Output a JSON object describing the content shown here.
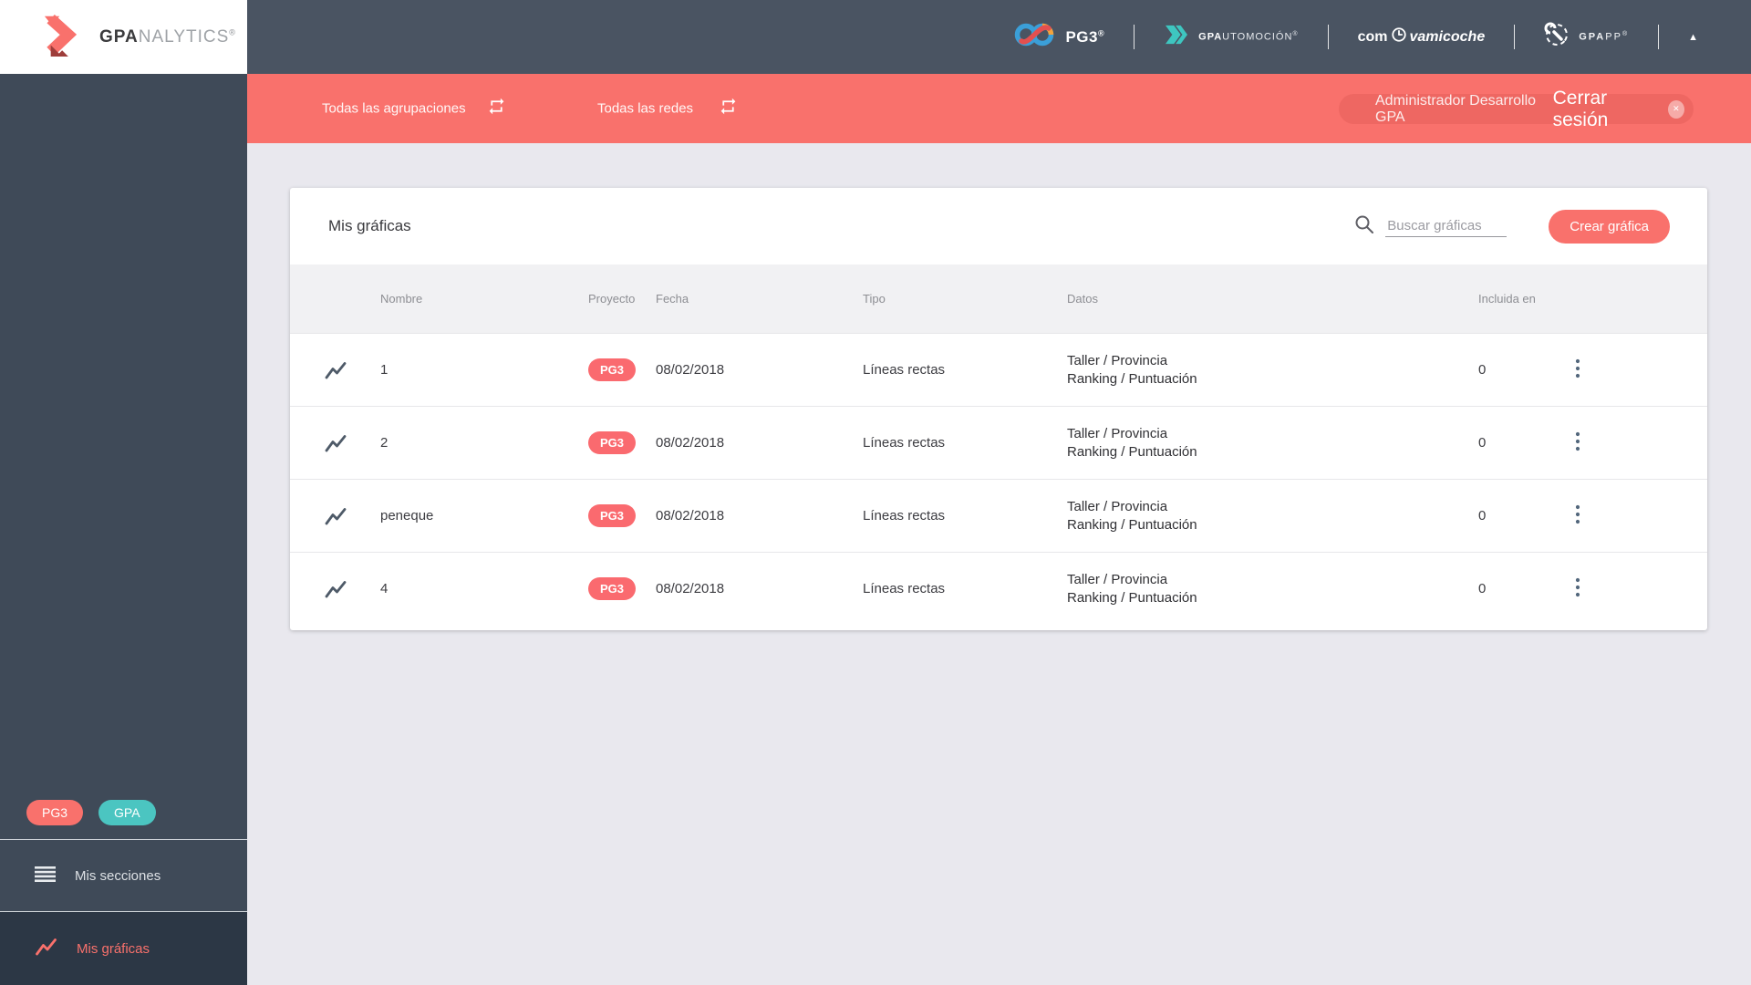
{
  "brand": {
    "name_bold": "GPA",
    "name_light": "NALYTICS",
    "reg": "®"
  },
  "header": {
    "pg3": {
      "label": "PG3",
      "reg": "®"
    },
    "gpautomocion": {
      "bold": "GPA",
      "rest": "UTOMOCIÓN",
      "reg": "®"
    },
    "compravamicoche": {
      "pre": "com",
      "post": "vamicoche"
    },
    "gpapp": {
      "bold": "GPA",
      "rest": "PP",
      "reg": "®"
    },
    "collapse_arrow": "▲"
  },
  "filterbar": {
    "agrupaciones_label": "Todas las agrupaciones",
    "redes_label": "Todas las redes",
    "user_name": "Administrador Desarrollo GPA",
    "logout_label": "Cerrar sesión",
    "logout_icon": "✕"
  },
  "sidebar": {
    "badges": [
      {
        "label": "PG3",
        "color": "#f9716c"
      },
      {
        "label": "GPA",
        "color": "#4bc5c1"
      }
    ],
    "items": [
      {
        "label": "Mis secciones",
        "active": false
      },
      {
        "label": "Mis gráficas",
        "active": true
      }
    ]
  },
  "main": {
    "title": "Mis gráficas",
    "search_placeholder": "Buscar gráficas",
    "create_button": "Crear gráfica",
    "table": {
      "columns": [
        "Nombre",
        "Proyecto",
        "Fecha",
        "Tipo",
        "Datos",
        "Incluida en"
      ],
      "rows": [
        {
          "nombre": "1",
          "proyecto": "PG3",
          "fecha": "08/02/2018",
          "tipo": "Líneas rectas",
          "datos_line1": "Taller / Provincia",
          "datos_line2": "Ranking / Puntuación",
          "incluida": "0"
        },
        {
          "nombre": "2",
          "proyecto": "PG3",
          "fecha": "08/02/2018",
          "tipo": "Líneas rectas",
          "datos_line1": "Taller / Provincia",
          "datos_line2": "Ranking / Puntuación",
          "incluida": "0"
        },
        {
          "nombre": "peneque",
          "proyecto": "PG3",
          "fecha": "08/02/2018",
          "tipo": "Líneas rectas",
          "datos_line1": "Taller / Provincia",
          "datos_line2": "Ranking / Puntuación",
          "incluida": "0"
        },
        {
          "nombre": "4",
          "proyecto": "PG3",
          "fecha": "08/02/2018",
          "tipo": "Líneas rectas",
          "datos_line1": "Taller / Provincia",
          "datos_line2": "Ranking / Puntuación",
          "incluida": "0"
        }
      ]
    }
  },
  "colors": {
    "accent_coral": "#f9716c",
    "teal": "#4bc5c1",
    "header_dark": "#4a5462",
    "sidebar_dark": "#3f4a58",
    "sidebar_active": "#2c3745",
    "content_bg": "#e9e8ee"
  }
}
